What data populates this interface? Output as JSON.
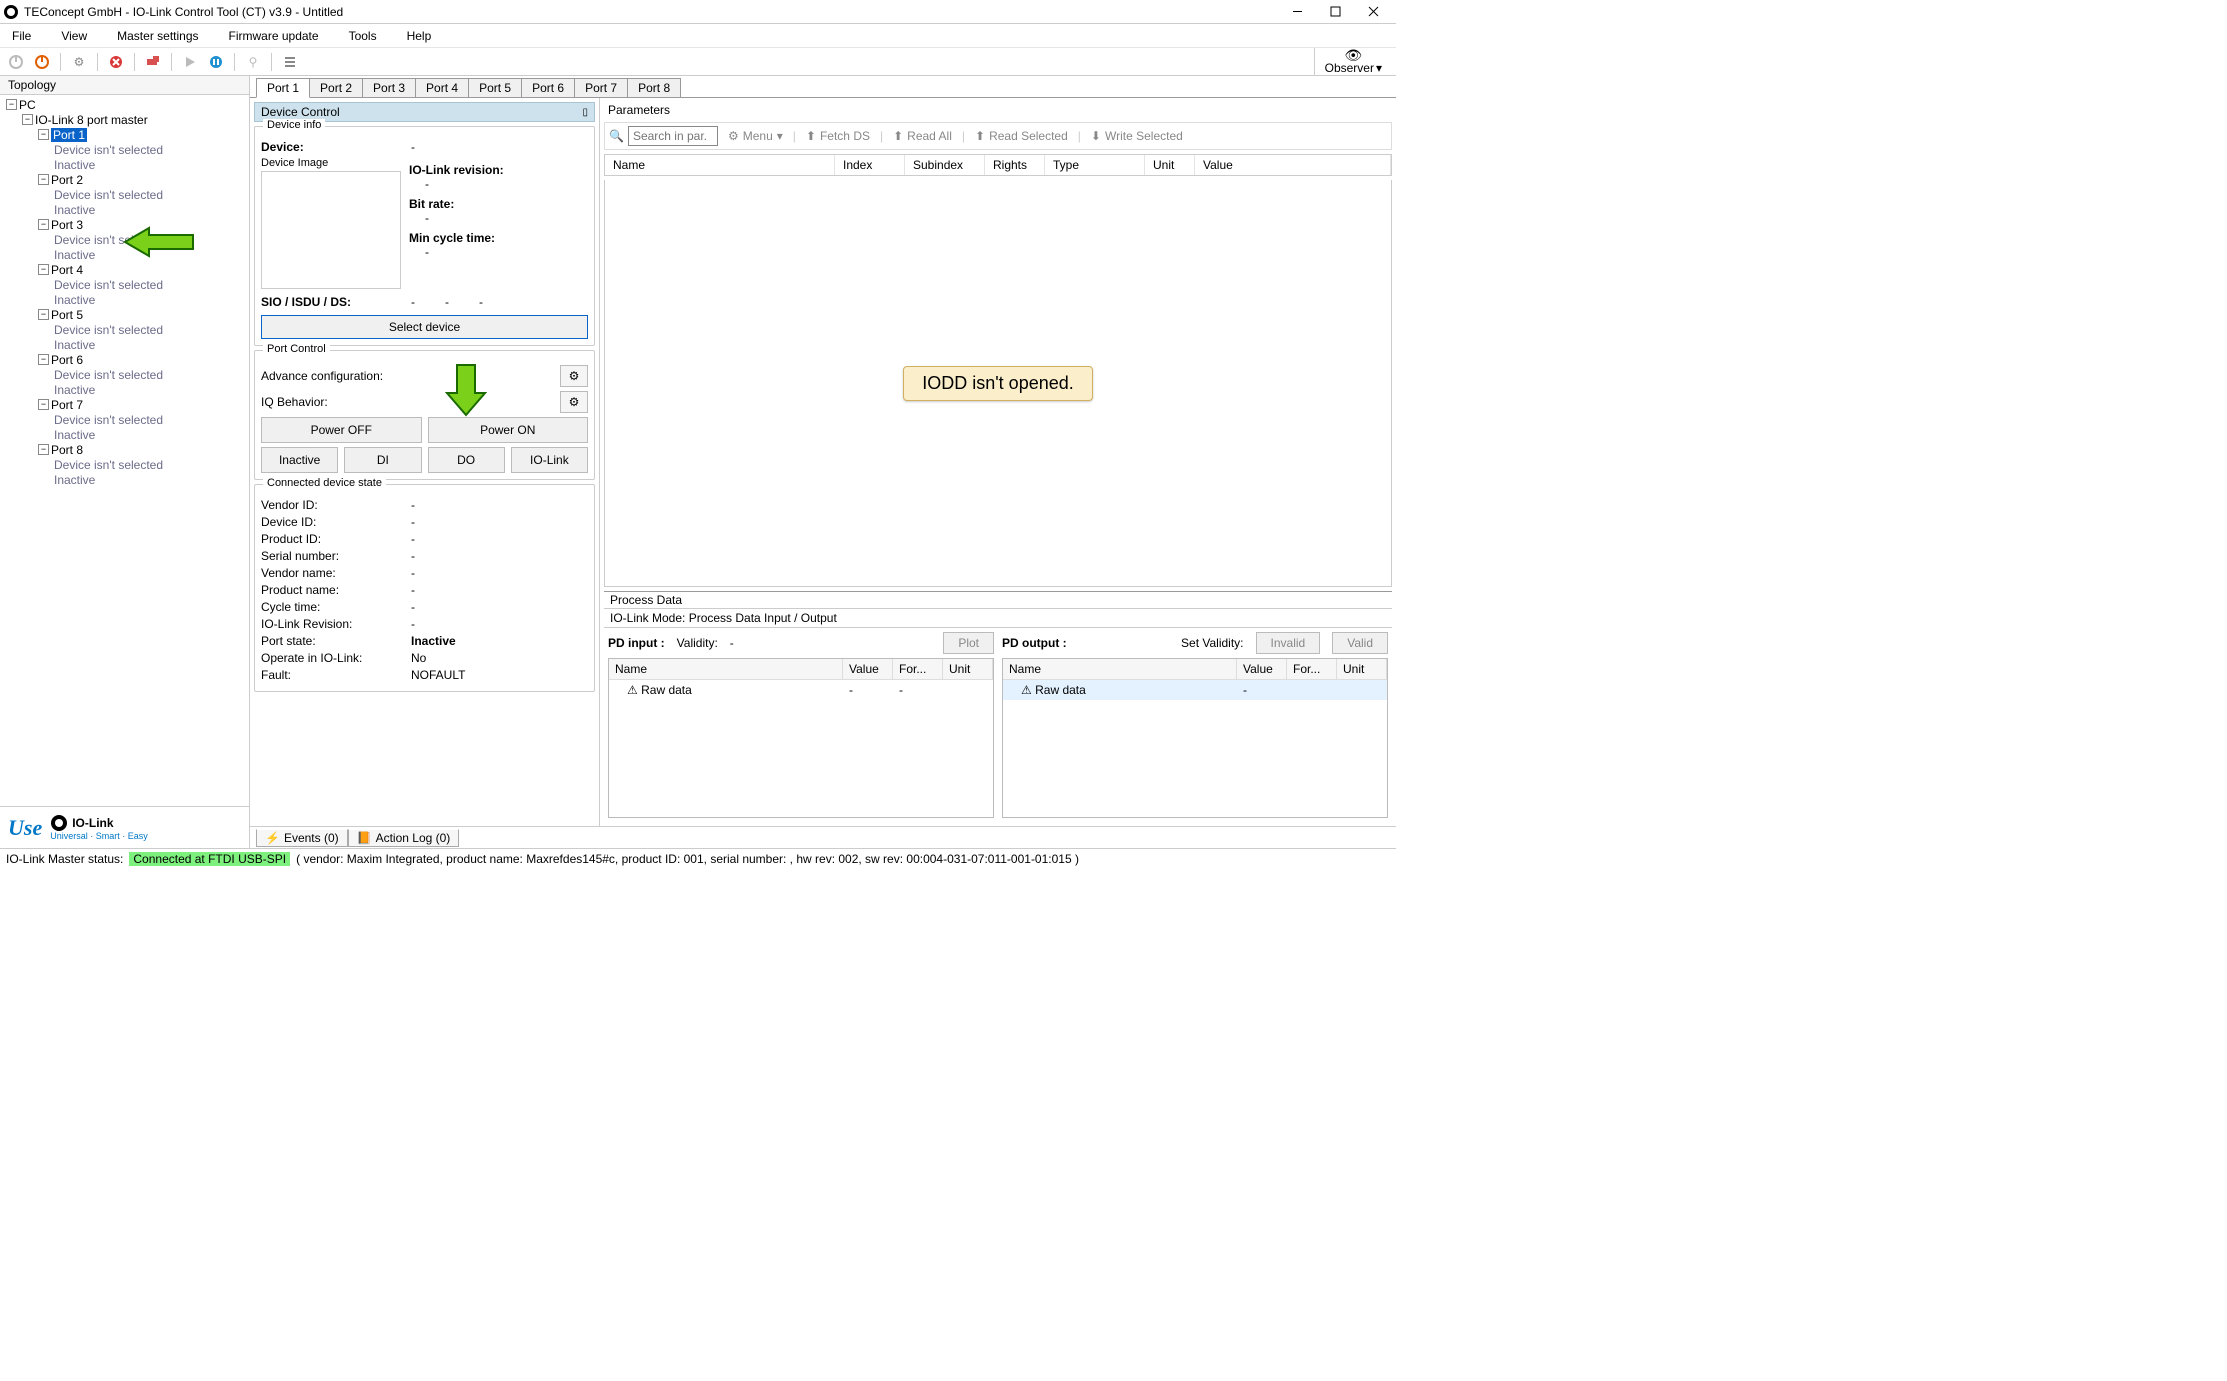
{
  "window": {
    "title": "TEConcept GmbH - IO-Link Control Tool (CT) v3.9 - Untitled"
  },
  "menubar": [
    "File",
    "View",
    "Master settings",
    "Firmware update",
    "Tools",
    "Help"
  ],
  "observer": {
    "label": "Observer"
  },
  "topology": {
    "header": "Topology",
    "root": "PC",
    "master": "IO-Link 8 port master",
    "ports": [
      {
        "name": "Port 1",
        "sub1": "Device isn't selected",
        "sub2": "Inactive"
      },
      {
        "name": "Port 2",
        "sub1": "Device isn't selected",
        "sub2": "Inactive"
      },
      {
        "name": "Port 3",
        "sub1": "Device isn't selected",
        "sub2": "Inactive"
      },
      {
        "name": "Port 4",
        "sub1": "Device isn't selected",
        "sub2": "Inactive"
      },
      {
        "name": "Port 5",
        "sub1": "Device isn't selected",
        "sub2": "Inactive"
      },
      {
        "name": "Port 6",
        "sub1": "Device isn't selected",
        "sub2": "Inactive"
      },
      {
        "name": "Port 7",
        "sub1": "Device isn't selected",
        "sub2": "Inactive"
      },
      {
        "name": "Port 8",
        "sub1": "Device isn't selected",
        "sub2": "Inactive"
      }
    ]
  },
  "brand": {
    "use": "Use",
    "iolink": "IO-Link",
    "tagline": "Universal · Smart · Easy"
  },
  "tabs": [
    "Port 1",
    "Port 2",
    "Port 3",
    "Port 4",
    "Port 5",
    "Port 6",
    "Port 7",
    "Port 8"
  ],
  "device_control": {
    "header": "Device Control",
    "device_label": "Device:",
    "device_value": "-",
    "image_label": "Device Image",
    "info_group": "Device info",
    "items": [
      {
        "label": "IO-Link revision:",
        "value": "-"
      },
      {
        "label": "Bit rate:",
        "value": "-"
      },
      {
        "label": "Min cycle time:",
        "value": "-"
      }
    ],
    "sio_label": "SIO / ISDU / DS:",
    "sio_v1": "-",
    "sio_v2": "-",
    "sio_v3": "-",
    "select_btn": "Select device"
  },
  "port_control": {
    "header": "Port Control",
    "adv": "Advance configuration:",
    "iq": "IQ Behavior:",
    "power_off": "Power OFF",
    "power_on": "Power ON",
    "b1": "Inactive",
    "b2": "DI",
    "b3": "DO",
    "b4": "IO-Link"
  },
  "conn_state": {
    "header": "Connected device state",
    "rows": [
      {
        "k": "Vendor ID:",
        "v": "-"
      },
      {
        "k": "Device ID:",
        "v": "-"
      },
      {
        "k": "Product ID:",
        "v": "-"
      },
      {
        "k": "Serial number:",
        "v": "-"
      },
      {
        "k": "Vendor name:",
        "v": "-"
      },
      {
        "k": "Product name:",
        "v": "-"
      },
      {
        "k": "Cycle time:",
        "v": "-"
      },
      {
        "k": "IO-Link Revision:",
        "v": "-"
      },
      {
        "k": "Port state:",
        "v": "Inactive",
        "bold": true
      },
      {
        "k": "Operate in IO-Link:",
        "v": "No"
      },
      {
        "k": "Fault:",
        "v": "NOFAULT"
      }
    ]
  },
  "parameters": {
    "header": "Parameters",
    "search_placeholder": "Search in par.",
    "menu": "Menu",
    "fetch_ds": "Fetch DS",
    "read_all": "Read All",
    "read_selected": "Read Selected",
    "write_selected": "Write Selected",
    "cols": {
      "name": "Name",
      "index": "Index",
      "subindex": "Subindex",
      "rights": "Rights",
      "type": "Type",
      "unit": "Unit",
      "value": "Value"
    },
    "empty_msg": "IODD isn't opened."
  },
  "process_data": {
    "header": "Process Data",
    "mode": "IO-Link Mode: Process Data Input / Output",
    "pd_input_label": "PD input :",
    "validity_label": "Validity:",
    "validity_value": "-",
    "plot": "Plot",
    "pd_output_label": "PD output :",
    "set_validity_label": "Set Validity:",
    "invalid": "Invalid",
    "valid": "Valid",
    "grid_cols": {
      "name": "Name",
      "value": "Value",
      "format": "For...",
      "unit": "Unit"
    },
    "raw": "Raw data",
    "dash": "-"
  },
  "bottom_tabs": {
    "events": "Events (0)",
    "action_log": "Action Log (0)"
  },
  "status": {
    "label": "IO-Link Master status:",
    "conn": "Connected at FTDI USB-SPI",
    "rest": "( vendor: Maxim Integrated, product name: Maxrefdes145#c, product ID: 001, serial number: , hw rev: 002, sw rev: 00:004-031-07:011-001-01:015 )"
  }
}
